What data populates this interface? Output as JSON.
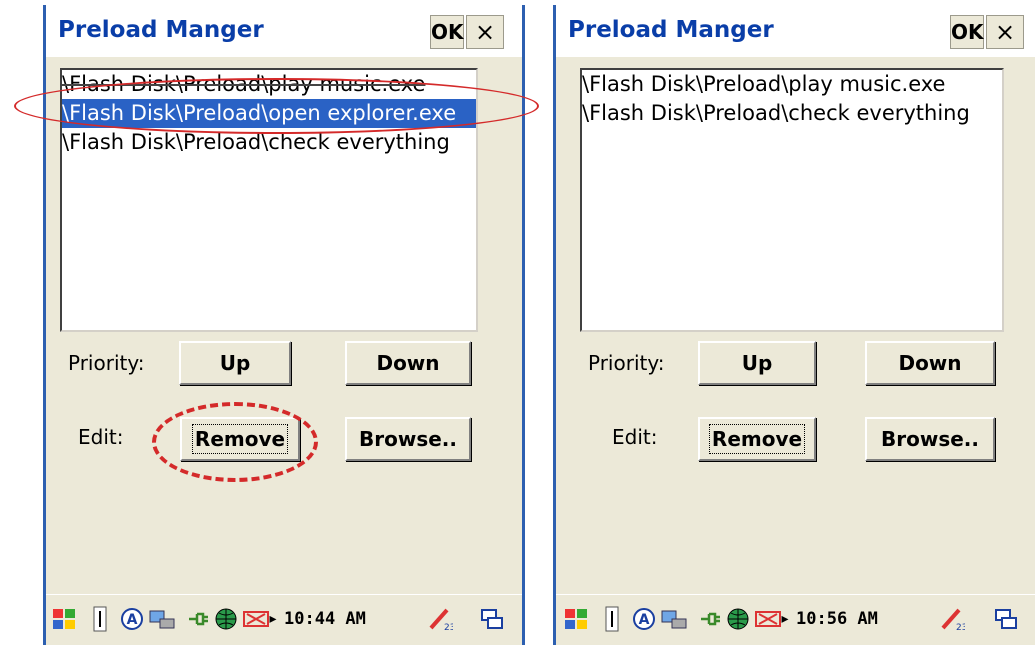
{
  "panels": [
    {
      "title": "Preload Manger",
      "ok_label": "OK",
      "close_label": "×",
      "list_items": [
        "\\Flash Disk\\Preload\\play music.exe",
        "\\Flash Disk\\Preload\\open explorer.exe",
        "\\Flash Disk\\Preload\\check everything"
      ],
      "selected_index": 1,
      "priority_label": "Priority:",
      "up_label": "Up",
      "down_label": "Down",
      "edit_label": "Edit:",
      "remove_label": "Remove",
      "browse_label": "Browse..",
      "clock": "10:44 AM"
    },
    {
      "title": "Preload Manger",
      "ok_label": "OK",
      "close_label": "×",
      "list_items": [
        "\\Flash Disk\\Preload\\play music.exe",
        "\\Flash Disk\\Preload\\check everything"
      ],
      "priority_label": "Priority:",
      "up_label": "Up",
      "down_label": "Down",
      "edit_label": "Edit:",
      "remove_label": "Remove",
      "browse_label": "Browse..",
      "clock": "10:56 AM"
    }
  ],
  "taskbar_icons": [
    "windows-start-icon",
    "input-panel-icon",
    "a-input-icon",
    "network-icon",
    "power-plug-icon",
    "globe-icon",
    "volume-muted-icon",
    "arrow-icon",
    "pen-input-icon",
    "switch-window-icon"
  ],
  "colors": {
    "title_text": "#0a3ea8",
    "selection": "#2a62c5",
    "annotation": "#d42a2a",
    "frame": "#2d5fb0"
  }
}
